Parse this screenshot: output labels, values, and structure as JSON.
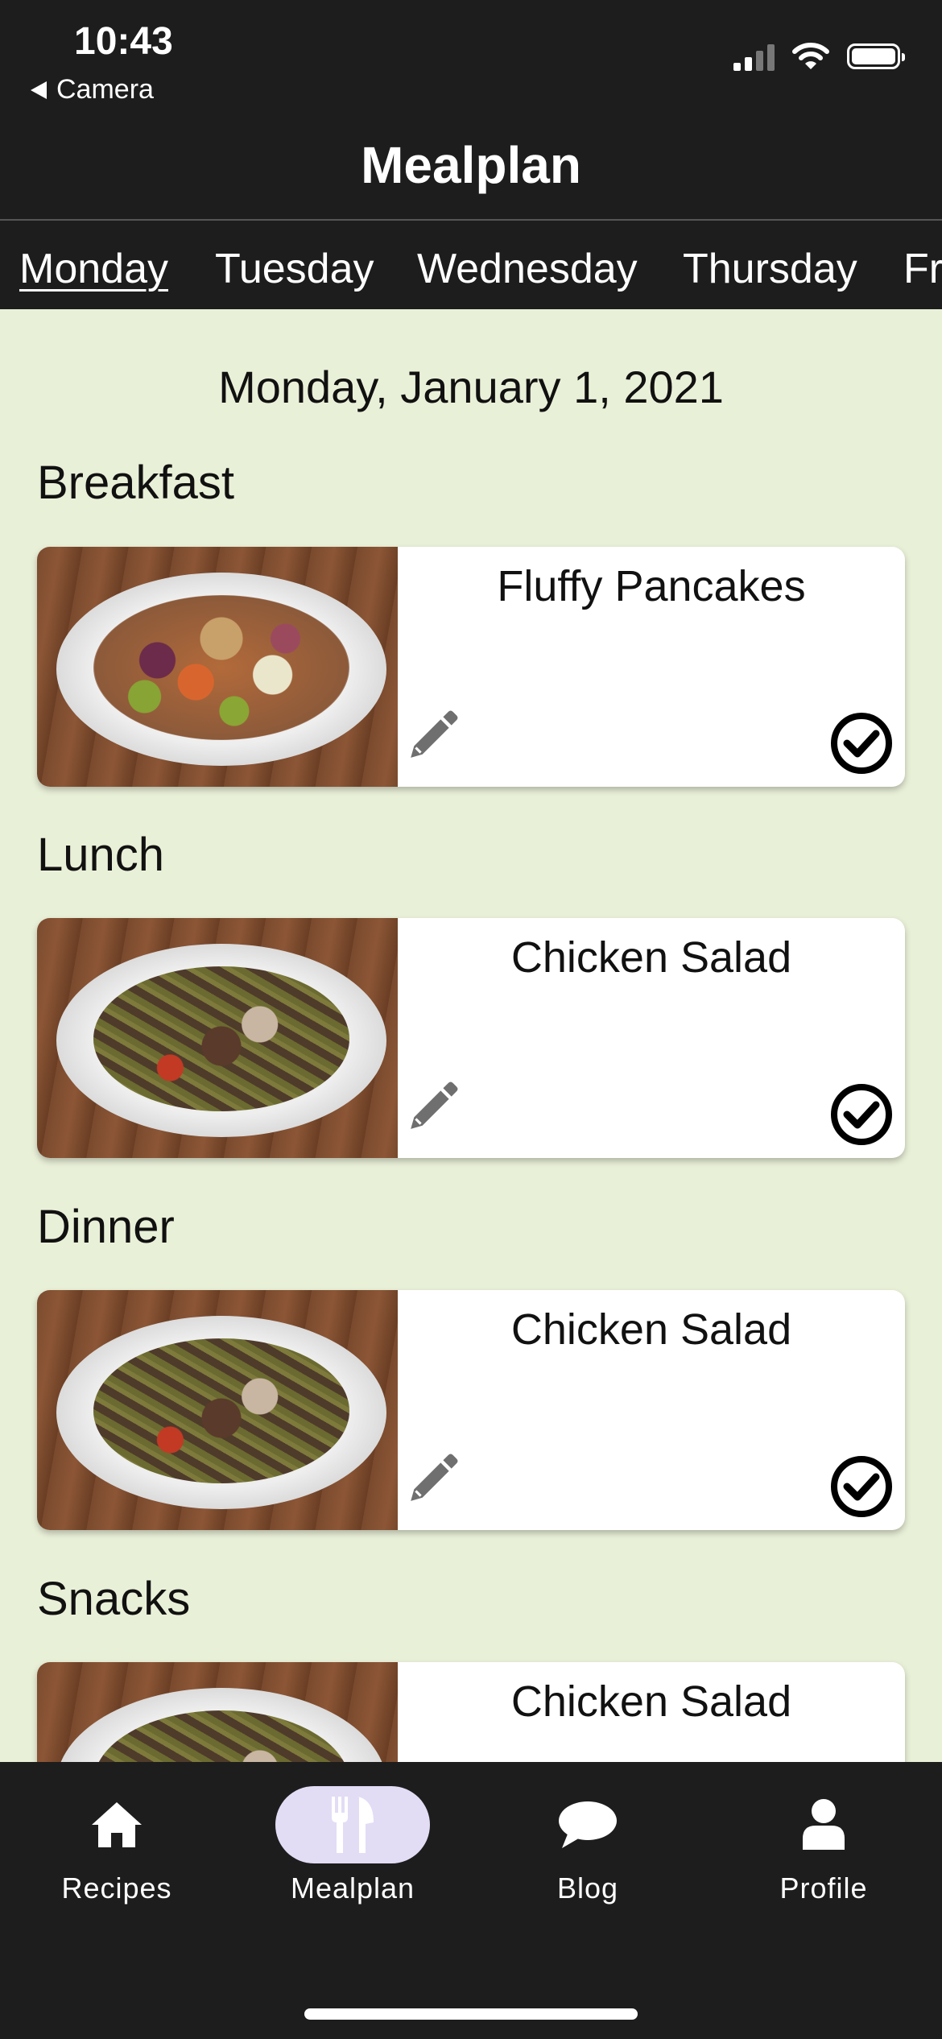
{
  "status_bar": {
    "time": "10:43",
    "back_label": "Camera"
  },
  "header": {
    "title": "Mealplan"
  },
  "day_tabs": [
    {
      "label": "Monday",
      "active": true
    },
    {
      "label": "Tuesday",
      "active": false
    },
    {
      "label": "Wednesday",
      "active": false
    },
    {
      "label": "Thursday",
      "active": false
    },
    {
      "label": "Fr",
      "active": false
    }
  ],
  "date_heading": "Monday, January 1, 2021",
  "meals": [
    {
      "section": "Breakfast",
      "recipe": "Fluffy Pancakes"
    },
    {
      "section": "Lunch",
      "recipe": "Chicken Salad"
    },
    {
      "section": "Dinner",
      "recipe": "Chicken Salad"
    },
    {
      "section": "Snacks",
      "recipe": "Chicken Salad"
    }
  ],
  "bottom_nav": [
    {
      "label": "Recipes",
      "icon": "home-icon",
      "active": false
    },
    {
      "label": "Mealplan",
      "icon": "utensils-icon",
      "active": true
    },
    {
      "label": "Blog",
      "icon": "chat-bubble-icon",
      "active": false
    },
    {
      "label": "Profile",
      "icon": "user-icon",
      "active": false
    }
  ]
}
